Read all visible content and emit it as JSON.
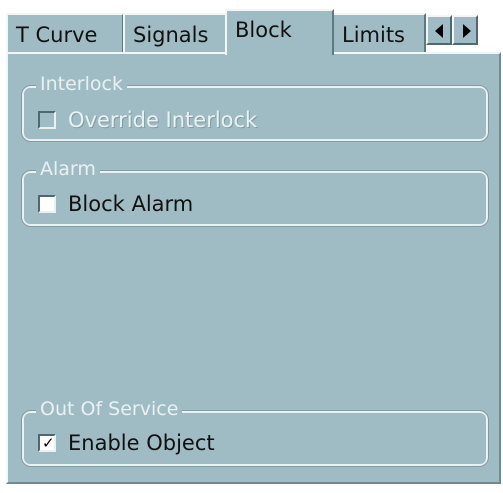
{
  "tabs": [
    {
      "label": "T Curve",
      "active": false
    },
    {
      "label": "Signals",
      "active": false
    },
    {
      "label": "Block",
      "active": true
    },
    {
      "label": "Limits",
      "active": false
    }
  ],
  "tab_scroll": {
    "left_icon": "arrow-left-icon",
    "right_icon": "arrow-right-icon"
  },
  "groups": {
    "interlock": {
      "title": "Interlock",
      "checkbox_label": "Override Interlock",
      "checked": false,
      "enabled": false
    },
    "alarm": {
      "title": "Alarm",
      "checkbox_label": "Block Alarm",
      "checked": false,
      "enabled": true
    },
    "out_of_service": {
      "title": "Out Of Service",
      "checkbox_label": "Enable Object",
      "checked": true,
      "enabled": true
    }
  },
  "colors": {
    "panel_background": "#9fbcc5",
    "disabled_text": "#e9f1f3"
  }
}
